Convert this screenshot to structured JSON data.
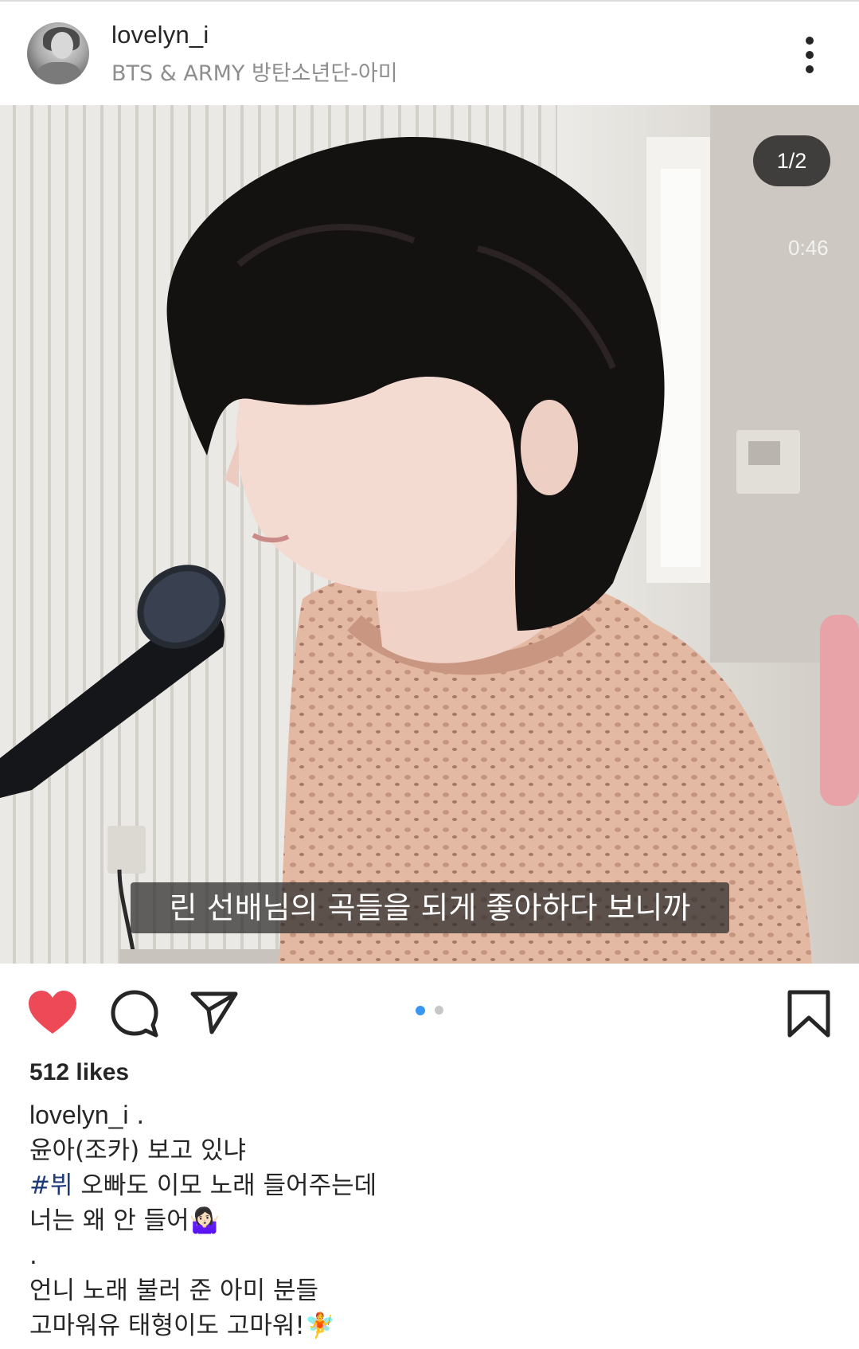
{
  "header": {
    "username": "lovelyn_i",
    "subtitle": "BTS & ARMY 방탄소년단-아미"
  },
  "media": {
    "counter": "1/2",
    "timer": "0:46",
    "video_subtitle": "린 선배님의 곡들을 되게 좋아하다 보니까"
  },
  "actions": {
    "like_color": "#ed4956",
    "carousel_active_color": "#3897f0",
    "carousel_inactive_color": "#c7c7c7",
    "icons": [
      "heart-icon",
      "comment-icon",
      "share-icon",
      "bookmark-icon"
    ]
  },
  "post": {
    "likes": "512 likes",
    "caption_username": "lovelyn_i",
    "caption_first": ".",
    "lines": {
      "l1": "윤아(조카) 보고 있냐",
      "l2_tag": "#뷔",
      "l2_rest": " 오빠도 이모 노래 들어주는데",
      "l3": "너는 왜 안 들어🤷🏻‍♀️",
      "l4": ".",
      "l5": "언니 노래 불러 준 아미 분들",
      "l6": "고마워유 태형이도 고마워!🧚"
    }
  }
}
